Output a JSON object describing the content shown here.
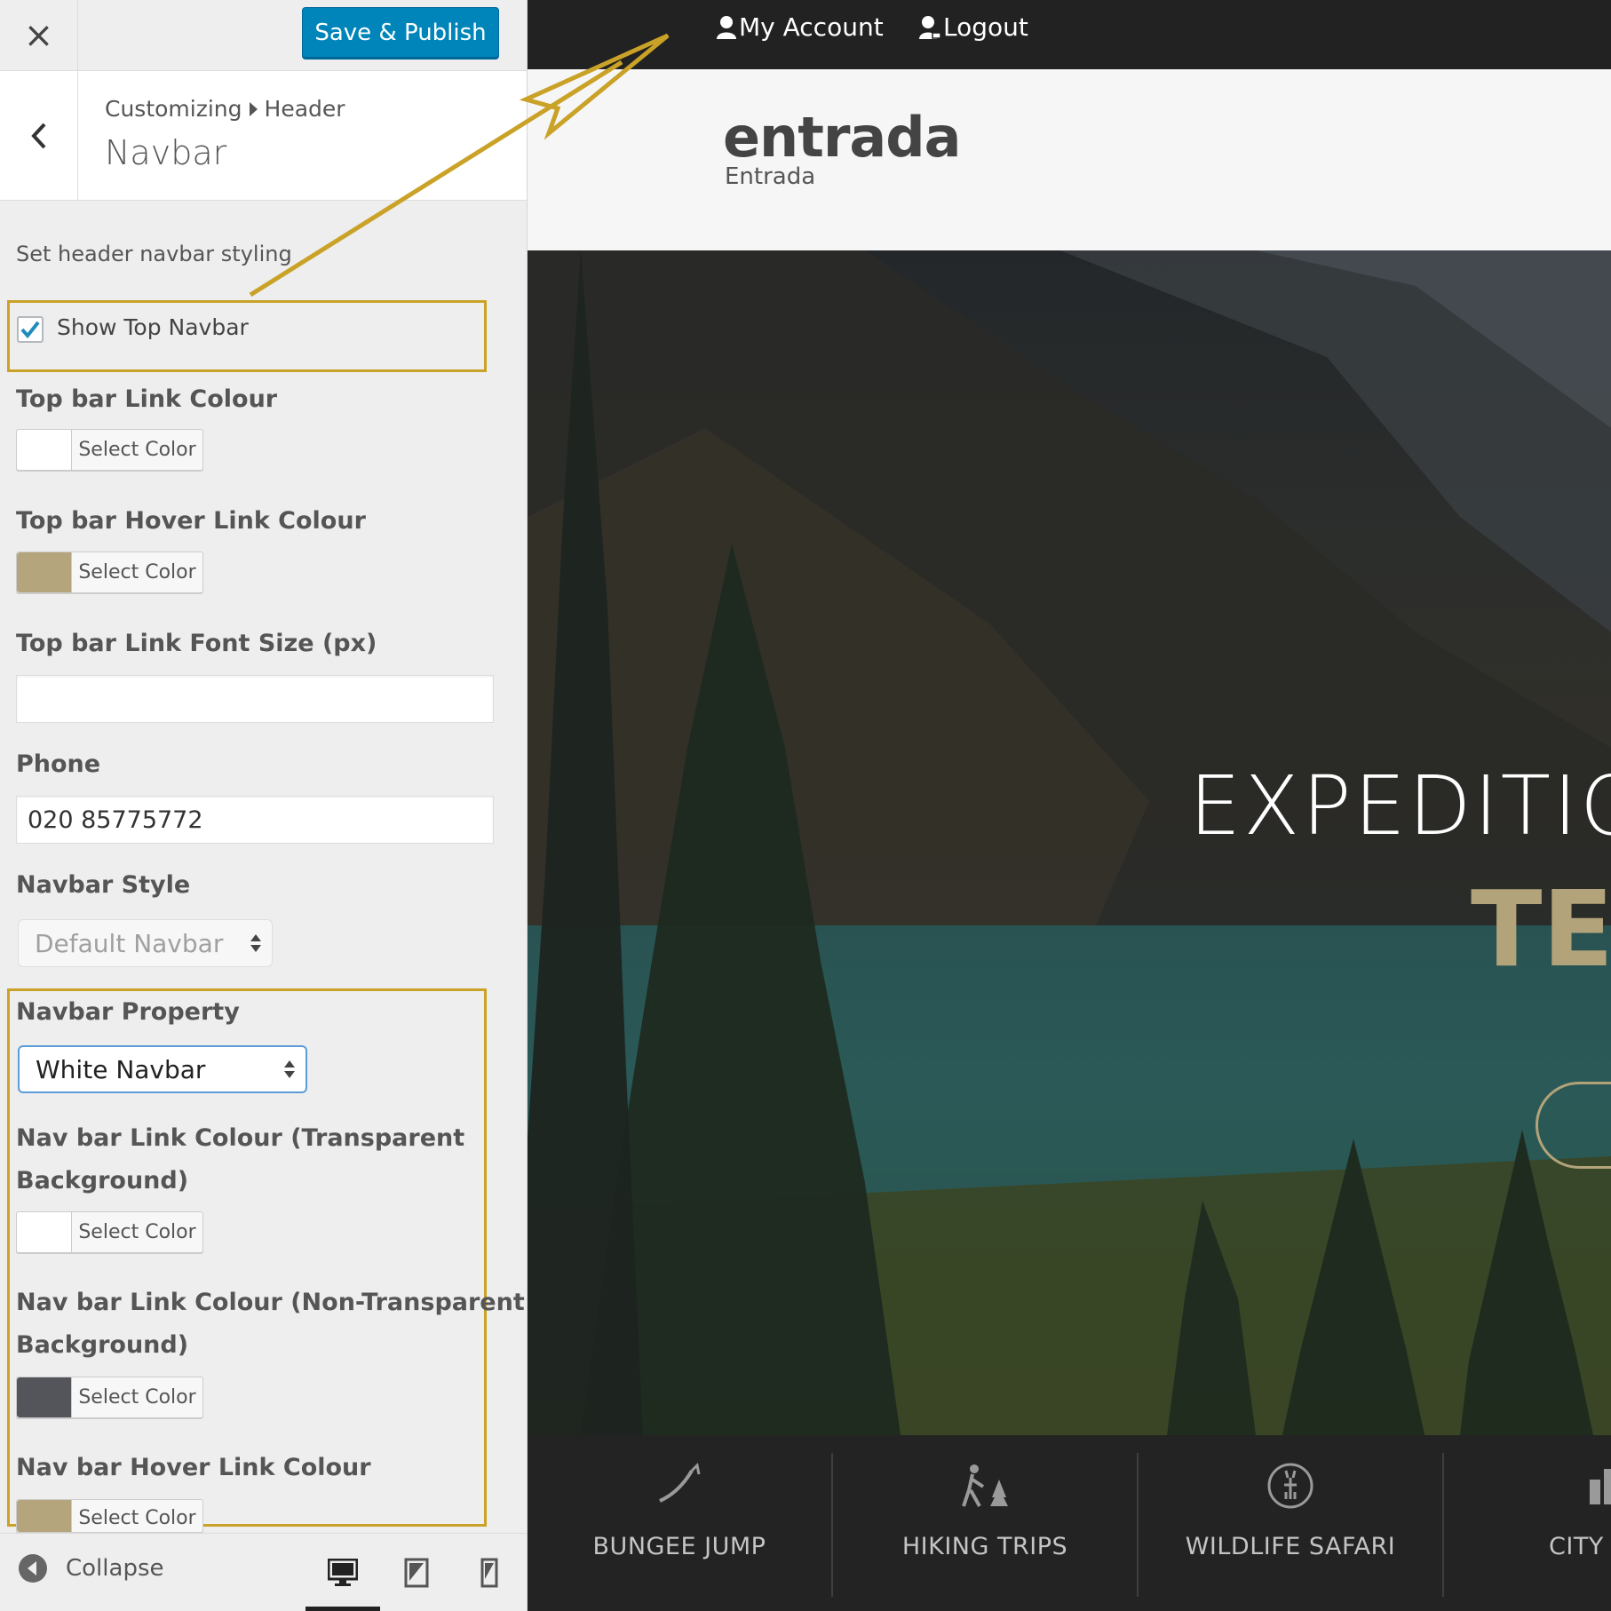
{
  "sidebar": {
    "save_label": "Save & Publish",
    "breadcrumb": {
      "root": "Customizing",
      "parent": "Header"
    },
    "section_title": "Navbar",
    "description": "Set header navbar styling",
    "show_top_navbar": {
      "label": "Show Top Navbar",
      "checked": true
    },
    "controls": {
      "top_link_colour": {
        "label": "Top bar Link Colour",
        "button": "Select Color",
        "color": "#ffffff"
      },
      "top_hover_colour": {
        "label": "Top bar Hover Link Colour",
        "button": "Select Color",
        "color": "#b4a57c"
      },
      "top_font_size": {
        "label": "Top bar Link Font Size (px)",
        "value": ""
      },
      "phone": {
        "label": "Phone",
        "value": "020 85775772"
      },
      "navbar_style": {
        "label": "Navbar Style",
        "value": "Default Navbar"
      },
      "navbar_property": {
        "label": "Navbar Property",
        "value": "White Navbar"
      },
      "nav_link_transparent": {
        "label_line1": "Nav bar Link Colour (Transparent",
        "label_line2": "Background)",
        "button": "Select Color",
        "color": "#ffffff"
      },
      "nav_link_nontransparent": {
        "label_line1": "Nav bar Link Colour (Non-Transparent",
        "label_line2": "Background)",
        "button": "Select Color",
        "color": "#53555a"
      },
      "nav_hover": {
        "label": "Nav bar Hover Link Colour",
        "button": "Select Color",
        "color": "#b4a57c"
      }
    },
    "footer": {
      "collapse_label": "Collapse"
    }
  },
  "preview": {
    "topbar_links": {
      "account": "My Account",
      "logout": "Logout"
    },
    "logo": "entrada",
    "tagline": "Entrada",
    "hero": {
      "title": "EXPEDITION",
      "subtitle": "TE"
    },
    "activities": [
      "BUNGEE JUMP",
      "HIKING TRIPS",
      "WILDLIFE SAFARI",
      "CITY TO"
    ]
  },
  "colors": {
    "accent": "#0085ba",
    "highlight": "#c9a227",
    "brand_gold": "#b2a37a"
  }
}
